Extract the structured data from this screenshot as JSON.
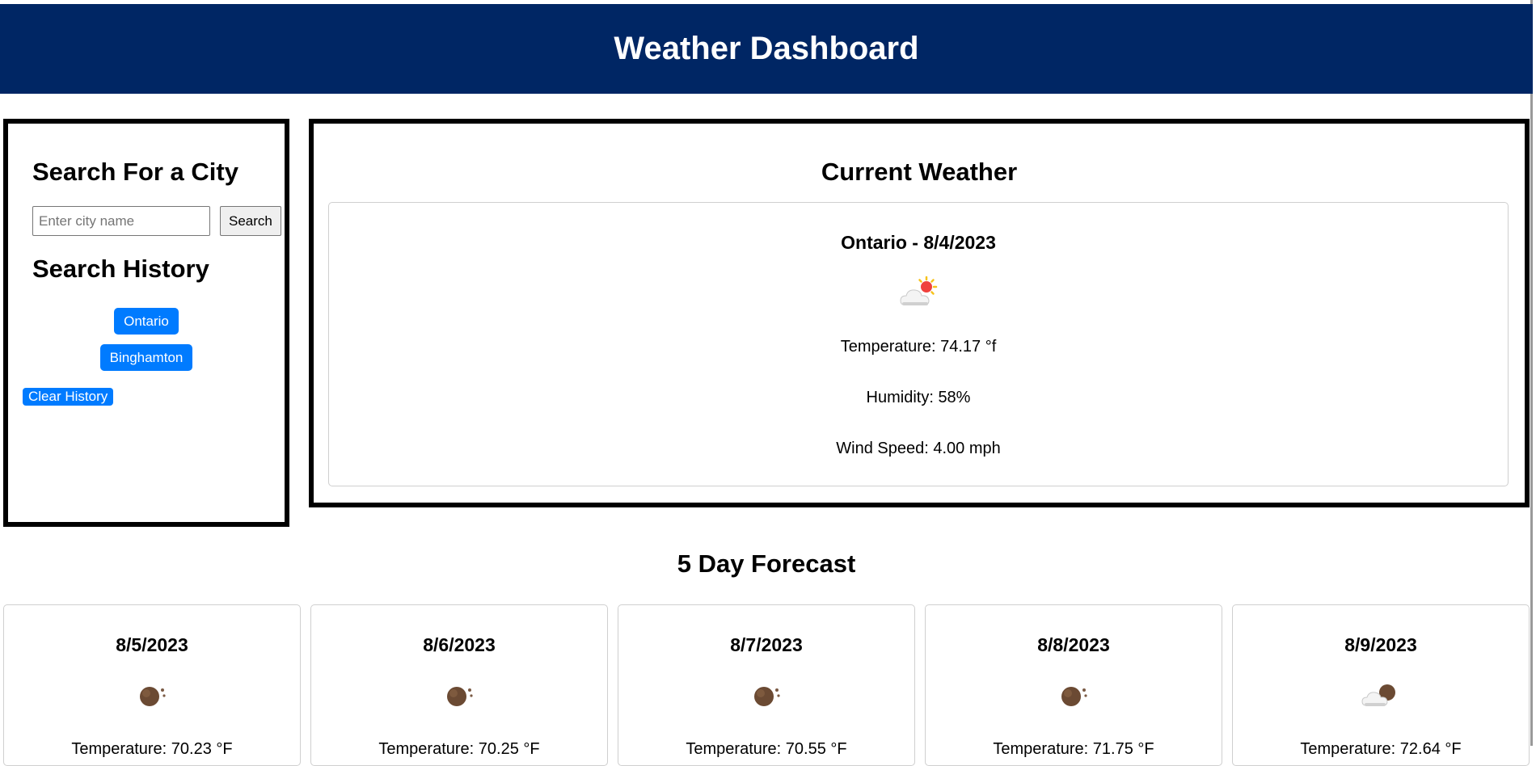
{
  "header": {
    "title": "Weather Dashboard"
  },
  "search": {
    "title": "Search For a City",
    "placeholder": "Enter city name",
    "value": "",
    "button_label": "Search"
  },
  "history": {
    "title": "Search History",
    "items": [
      "Ontario",
      "Binghamton"
    ],
    "clear_label": "Clear History"
  },
  "current": {
    "title": "Current Weather",
    "city_date": "Ontario - 8/4/2023",
    "icon": "partly-cloudy-day-icon",
    "temperature": "Temperature: 74.17 °f",
    "humidity": "Humidity: 58%",
    "wind": "Wind Speed: 4.00 mph"
  },
  "forecast": {
    "title": "5 Day Forecast",
    "days": [
      {
        "date": "8/5/2023",
        "icon": "clear-night-icon",
        "temp": "Temperature: 70.23 °F"
      },
      {
        "date": "8/6/2023",
        "icon": "clear-night-icon",
        "temp": "Temperature: 70.25 °F"
      },
      {
        "date": "8/7/2023",
        "icon": "clear-night-icon",
        "temp": "Temperature: 70.55 °F"
      },
      {
        "date": "8/8/2023",
        "icon": "clear-night-icon",
        "temp": "Temperature: 71.75 °F"
      },
      {
        "date": "8/9/2023",
        "icon": "partly-cloudy-night-icon",
        "temp": "Temperature: 72.64 °F"
      }
    ]
  },
  "colors": {
    "header_bg": "#002664",
    "accent": "#007bff"
  }
}
